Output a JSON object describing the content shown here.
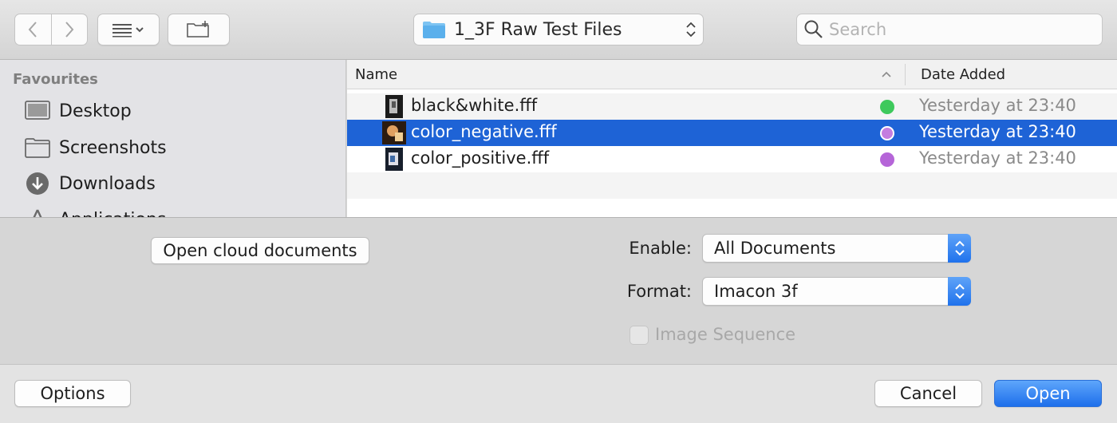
{
  "toolbar": {
    "back_icon": "chevron-left-icon",
    "forward_icon": "chevron-right-icon",
    "view_icon": "list-view-icon",
    "new_folder_icon": "new-folder-icon",
    "location": "1_3F Raw Test Files",
    "search_placeholder": "Search"
  },
  "sidebar": {
    "heading": "Favourites",
    "items": [
      {
        "label": "Desktop",
        "icon": "desktop-icon"
      },
      {
        "label": "Screenshots",
        "icon": "folder-icon"
      },
      {
        "label": "Downloads",
        "icon": "downloads-icon"
      },
      {
        "label": "Applications",
        "icon": "applications-icon"
      }
    ]
  },
  "filelist": {
    "columns": {
      "name": "Name",
      "date": "Date Added"
    },
    "rows": [
      {
        "name": "black&white.fff",
        "date": "Yesterday at 23:40",
        "tag_color": "#3ec95c",
        "selected": false
      },
      {
        "name": "color_negative.fff",
        "date": "Yesterday at 23:40",
        "tag_color": "#c47ddf",
        "selected": true
      },
      {
        "name": "color_positive.fff",
        "date": "Yesterday at 23:40",
        "tag_color": "#b565d8",
        "selected": false
      }
    ]
  },
  "accessory": {
    "cloud_button": "Open cloud documents",
    "enable_label": "Enable:",
    "enable_value": "All Documents",
    "format_label": "Format:",
    "format_value": "Imacon 3f",
    "image_sequence": "Image Sequence"
  },
  "bottom": {
    "options": "Options",
    "cancel": "Cancel",
    "open": "Open"
  },
  "colors": {
    "selection": "#1e63d6",
    "accent": "#1f72ec"
  }
}
